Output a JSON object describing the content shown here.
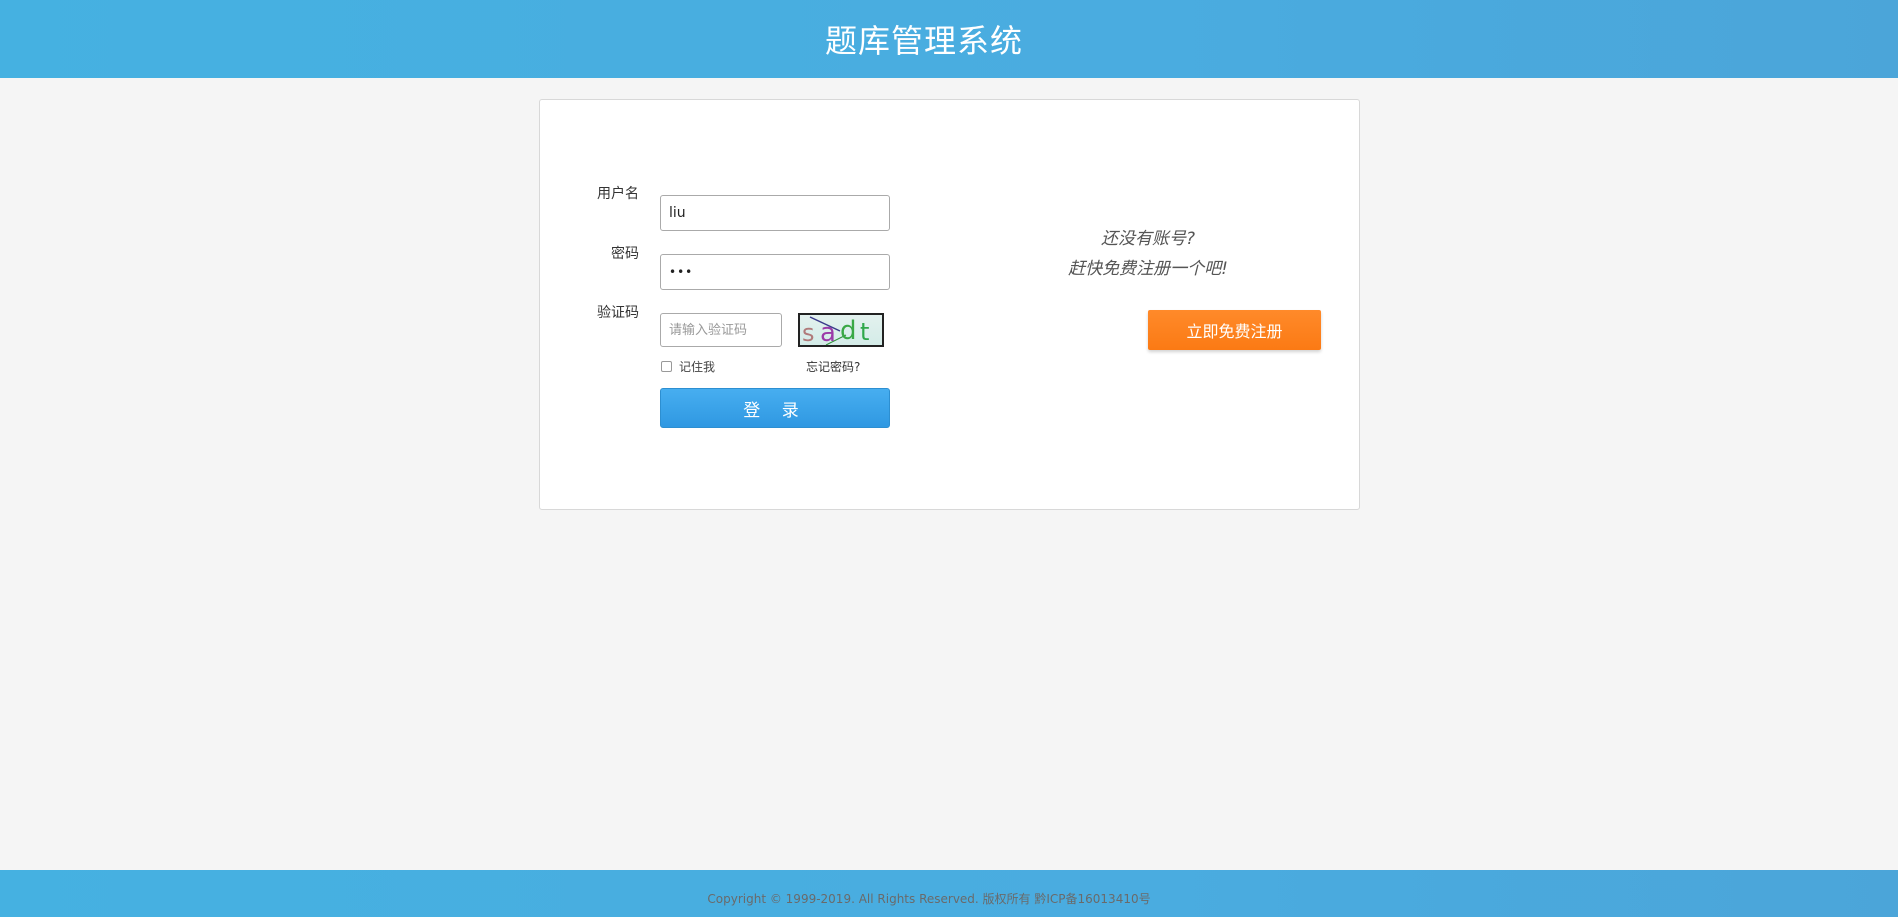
{
  "header": {
    "title": "题库管理系统"
  },
  "login_form": {
    "username_label": "用户名",
    "username_value": "liu",
    "password_label": "密码",
    "password_value": "•••",
    "captcha_label": "验证码",
    "captcha_placeholder": "请输入验证码",
    "captcha_text": "sadt",
    "remember_label": "记住我",
    "forgot_link": "忘记密码?",
    "login_button": "登 录"
  },
  "register_panel": {
    "line1": "还没有账号?",
    "line2": "赶快免费注册一个吧!",
    "register_button": "立即免费注册"
  },
  "footer": {
    "copyright": "Copyright © 1999-2019. All Rights Reserved. 版权所有 黔ICP备16013410号"
  },
  "colors": {
    "header_bg": "#4aace0",
    "login_button": "#3aa3ea",
    "register_button": "#fb7e1a"
  }
}
